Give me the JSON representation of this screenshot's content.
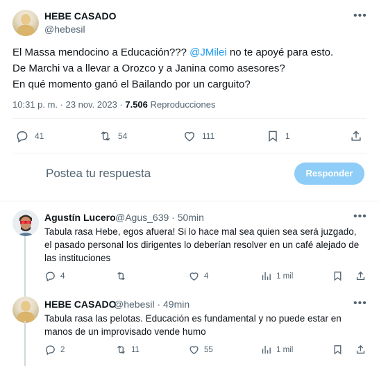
{
  "tweet": {
    "author_name": "HEBE CASADO",
    "author_handle": "@hebesil",
    "text_line1_pre": "El Massa mendocino a Educación??? ",
    "text_line1_mention": "@JMilei",
    "text_line1_post": " no te apoyé para esto.",
    "text_line2": "De Marchi va a llevar a Orozco y a Janina como asesores?",
    "text_line3": "En qué momento ganó el Bailando por un carguito?",
    "time": "10:31 p. m. · 23 nov. 2023 · ",
    "views_count": "7.506",
    "views_label": " Reproducciones",
    "stats": {
      "replies": "41",
      "retweets": "54",
      "likes": "111",
      "bookmarks": "1"
    }
  },
  "reply_box": {
    "placeholder": "Postea tu respuesta",
    "button": "Responder"
  },
  "replies": [
    {
      "author_name": "Agustín Lucero",
      "author_handle": "@Agus_639",
      "time": "· 50min",
      "line1": "Tabula rasa Hebe, egos afuera! Si lo hace mal sea quien sea será juzgado,",
      "line2": "el pasado personal los dirigentes lo deberían resolver en un café alejado de",
      "line3": "las instituciones",
      "stats": {
        "replies": "4",
        "retweets": "",
        "likes": "4",
        "views": "1 mil"
      }
    },
    {
      "author_name": "HEBE CASADO",
      "author_handle": "@hebesil",
      "time": "· 49min",
      "line1": "Tabula rasa las pelotas. Educación es fundamental y no puede estar en",
      "line2": "manos de un improvisado vende humo",
      "stats": {
        "replies": "2",
        "retweets": "11",
        "likes": "55",
        "views": "1 mil"
      }
    }
  ],
  "colors": {
    "accent": "#1d9bf0",
    "button_disabled": "#8ecdf7",
    "text": "#0f1419",
    "muted": "#536471"
  },
  "icons": [
    "more-icon",
    "reply-icon",
    "retweet-icon",
    "like-icon",
    "bookmark-icon",
    "share-icon",
    "views-icon"
  ]
}
